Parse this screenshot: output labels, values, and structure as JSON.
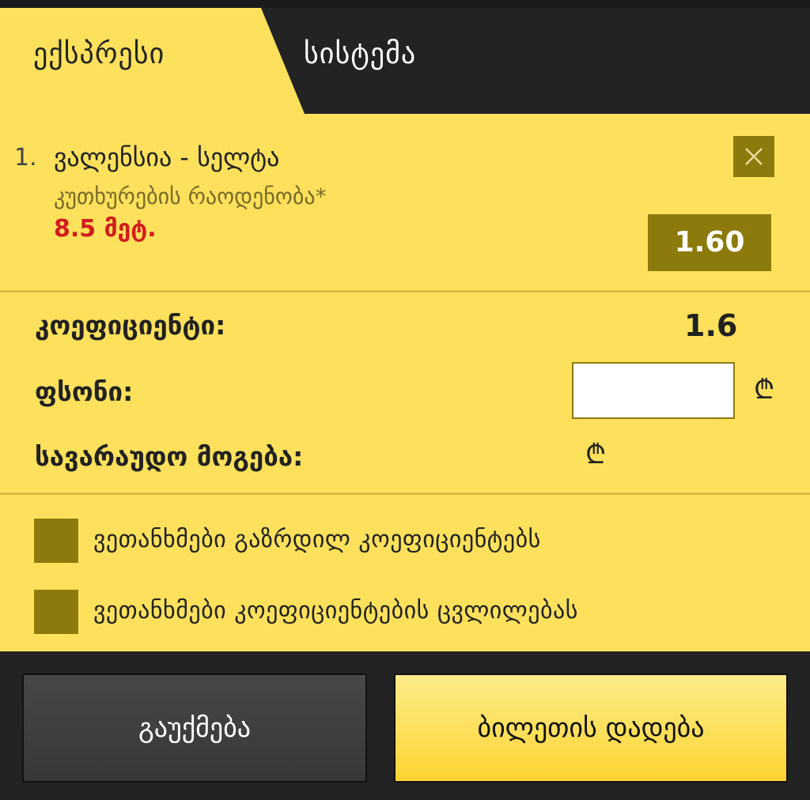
{
  "tabs": {
    "express": "ექსპრესი",
    "system": "სისტემა"
  },
  "bet": {
    "number": "1.",
    "match": "ვალენსია - სელტა",
    "market": "კუთხურების რაოდენობა*",
    "selection": "8.5 მეტ.",
    "odds": "1.60"
  },
  "summary": {
    "coef_label": "კოეფიციენტი:",
    "coef_value": "1.6",
    "stake_label": "ფსონი:",
    "stake_value": "",
    "potential_win_label": "სავარაუდო მოგება:",
    "currency_symbol": "₾"
  },
  "agreements": [
    {
      "label": "ვეთანხმები გაზრდილ კოეფიციენტებს"
    },
    {
      "label": "ვეთანხმები კოეფიციენტების ცვლილებას"
    }
  ],
  "footer": {
    "cancel_label": "გაუქმება",
    "place_label": "ბილეთის დადება"
  },
  "colors": {
    "panel": "#fde15c",
    "accent": "#8c7a0c",
    "dark": "#232323",
    "selection": "#d01e1e"
  }
}
